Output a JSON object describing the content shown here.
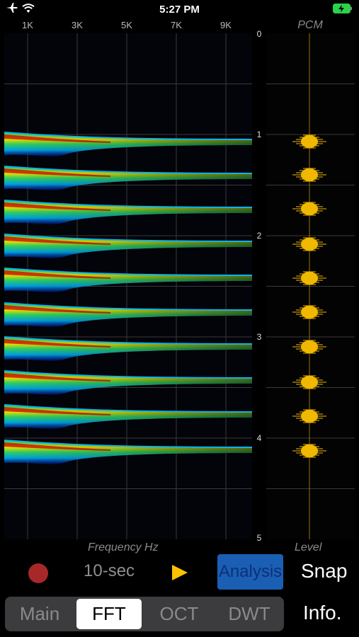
{
  "status_bar": {
    "time": "5:27 PM",
    "icons": [
      "airplane-icon",
      "wifi-icon",
      "battery-charging-icon"
    ]
  },
  "spectrogram": {
    "frequency_ticks": [
      "1K",
      "3K",
      "5K",
      "7K",
      "9K"
    ],
    "frequency_axis_label": "Frequency Hz",
    "time_ticks": [
      "0",
      "1",
      "2",
      "3",
      "4",
      "5"
    ],
    "pcm_label": "PCM",
    "level_label": "Level",
    "colors": {
      "hot": "#d40000",
      "warm": "#e8e000",
      "mid": "#20c860",
      "cool": "#00a0e0",
      "cold": "#0010c0",
      "pcm": "#f0b800"
    }
  },
  "controls": {
    "duration": "10-sec",
    "analysis_label": "Analysis",
    "snap_label": "Snap",
    "info_label": "Info."
  },
  "tabs": [
    {
      "label": "Main",
      "active": false
    },
    {
      "label": "FFT",
      "active": true
    },
    {
      "label": "OCT",
      "active": false
    },
    {
      "label": "DWT",
      "active": false
    }
  ]
}
